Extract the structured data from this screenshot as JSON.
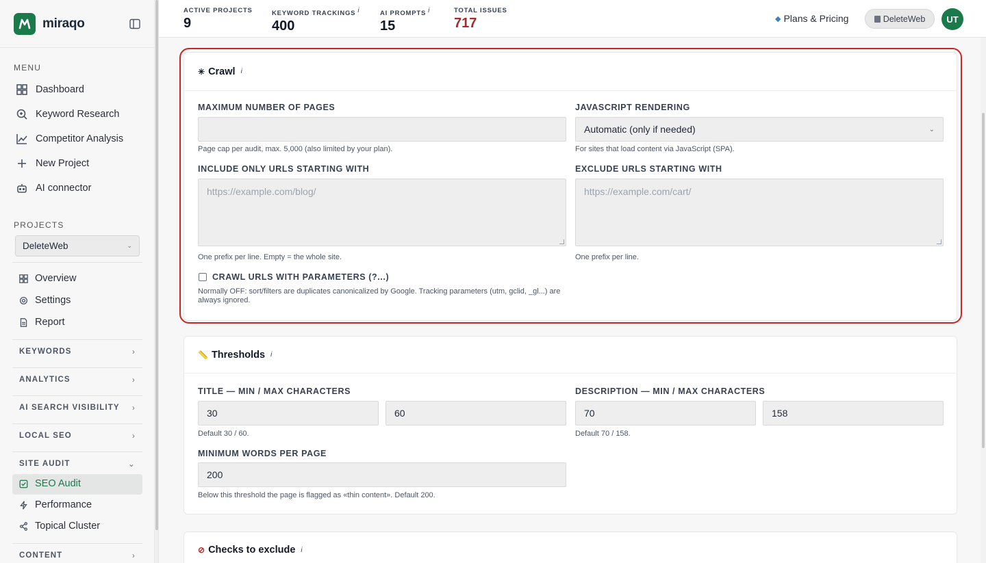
{
  "brand": {
    "name": "miraqo"
  },
  "sidebar": {
    "menu_label": "MENU",
    "menu": [
      {
        "label": "Dashboard",
        "icon": "grid-icon"
      },
      {
        "label": "Keyword Research",
        "icon": "search-icon"
      },
      {
        "label": "Competitor Analysis",
        "icon": "chart-line-icon"
      },
      {
        "label": "New Project",
        "icon": "plus-icon"
      },
      {
        "label": "AI connector",
        "icon": "robot-icon"
      }
    ],
    "projects_label": "PROJECTS",
    "project_selected": "DeleteWeb",
    "project_items": [
      {
        "label": "Overview",
        "icon": "grid-icon"
      },
      {
        "label": "Settings",
        "icon": "gear-icon"
      },
      {
        "label": "Report",
        "icon": "document-icon"
      }
    ],
    "groups": [
      {
        "label": "KEYWORDS"
      },
      {
        "label": "ANALYTICS"
      },
      {
        "label": "AI SEARCH VISIBILITY"
      },
      {
        "label": "LOCAL SEO"
      },
      {
        "label": "SITE AUDIT"
      }
    ],
    "site_audit_items": [
      {
        "label": "SEO Audit",
        "icon": "check-square-icon"
      },
      {
        "label": "Performance",
        "icon": "bolt-icon"
      },
      {
        "label": "Topical Cluster",
        "icon": "share-icon"
      }
    ],
    "content_label": "CONTENT"
  },
  "topbar": {
    "stats": [
      {
        "label": "ACTIVE PROJECTS",
        "value": "9",
        "info": ""
      },
      {
        "label": "KEYWORD TRACKINGS",
        "value": "400",
        "info": "i"
      },
      {
        "label": "AI PROMPTS",
        "value": "15",
        "info": "i"
      },
      {
        "label": "TOTAL ISSUES",
        "value": "717",
        "info": ""
      }
    ],
    "plans_label": "Plans & Pricing",
    "workspace_label": "DeleteWeb",
    "avatar_initials": "UT"
  },
  "crawl": {
    "title": "Crawl",
    "info": "i",
    "max_pages_label": "MAXIMUM NUMBER OF PAGES",
    "max_pages_value": "",
    "max_pages_help": "Page cap per audit, max. 5,000 (also limited by your plan).",
    "js_label": "JAVASCRIPT RENDERING",
    "js_value": "Automatic (only if needed)",
    "js_help": "For sites that load content via JavaScript (SPA).",
    "include_label": "INCLUDE ONLY URLS STARTING WITH",
    "include_placeholder": "https://example.com/blog/",
    "include_help": "One prefix per line. Empty = the whole site.",
    "exclude_label": "EXCLUDE URLS STARTING WITH",
    "exclude_placeholder": "https://example.com/cart/",
    "exclude_help": "One prefix per line.",
    "params_label": "CRAWL URLS WITH PARAMETERS (?...)",
    "params_help": "Normally OFF: sort/filters are duplicates canonicalized by Google. Tracking parameters (utm, gclid, _gl...) are always ignored."
  },
  "thresholds": {
    "title": "Thresholds",
    "info": "i",
    "title_label": "TITLE — MIN / MAX CHARACTERS",
    "title_min": "30",
    "title_max": "60",
    "title_help": "Default 30 / 60.",
    "desc_label": "DESCRIPTION — MIN / MAX CHARACTERS",
    "desc_min": "70",
    "desc_max": "158",
    "desc_help": "Default 70 / 158.",
    "words_label": "MINIMUM WORDS PER PAGE",
    "words_value": "200",
    "words_help": "Below this threshold the page is flagged as «thin content». Default 200."
  },
  "checks": {
    "title": "Checks to exclude",
    "info": "i"
  },
  "colors": {
    "brand_green": "#1a7a4c",
    "issues_red": "#a32b2b",
    "highlight_red": "#c62828"
  }
}
